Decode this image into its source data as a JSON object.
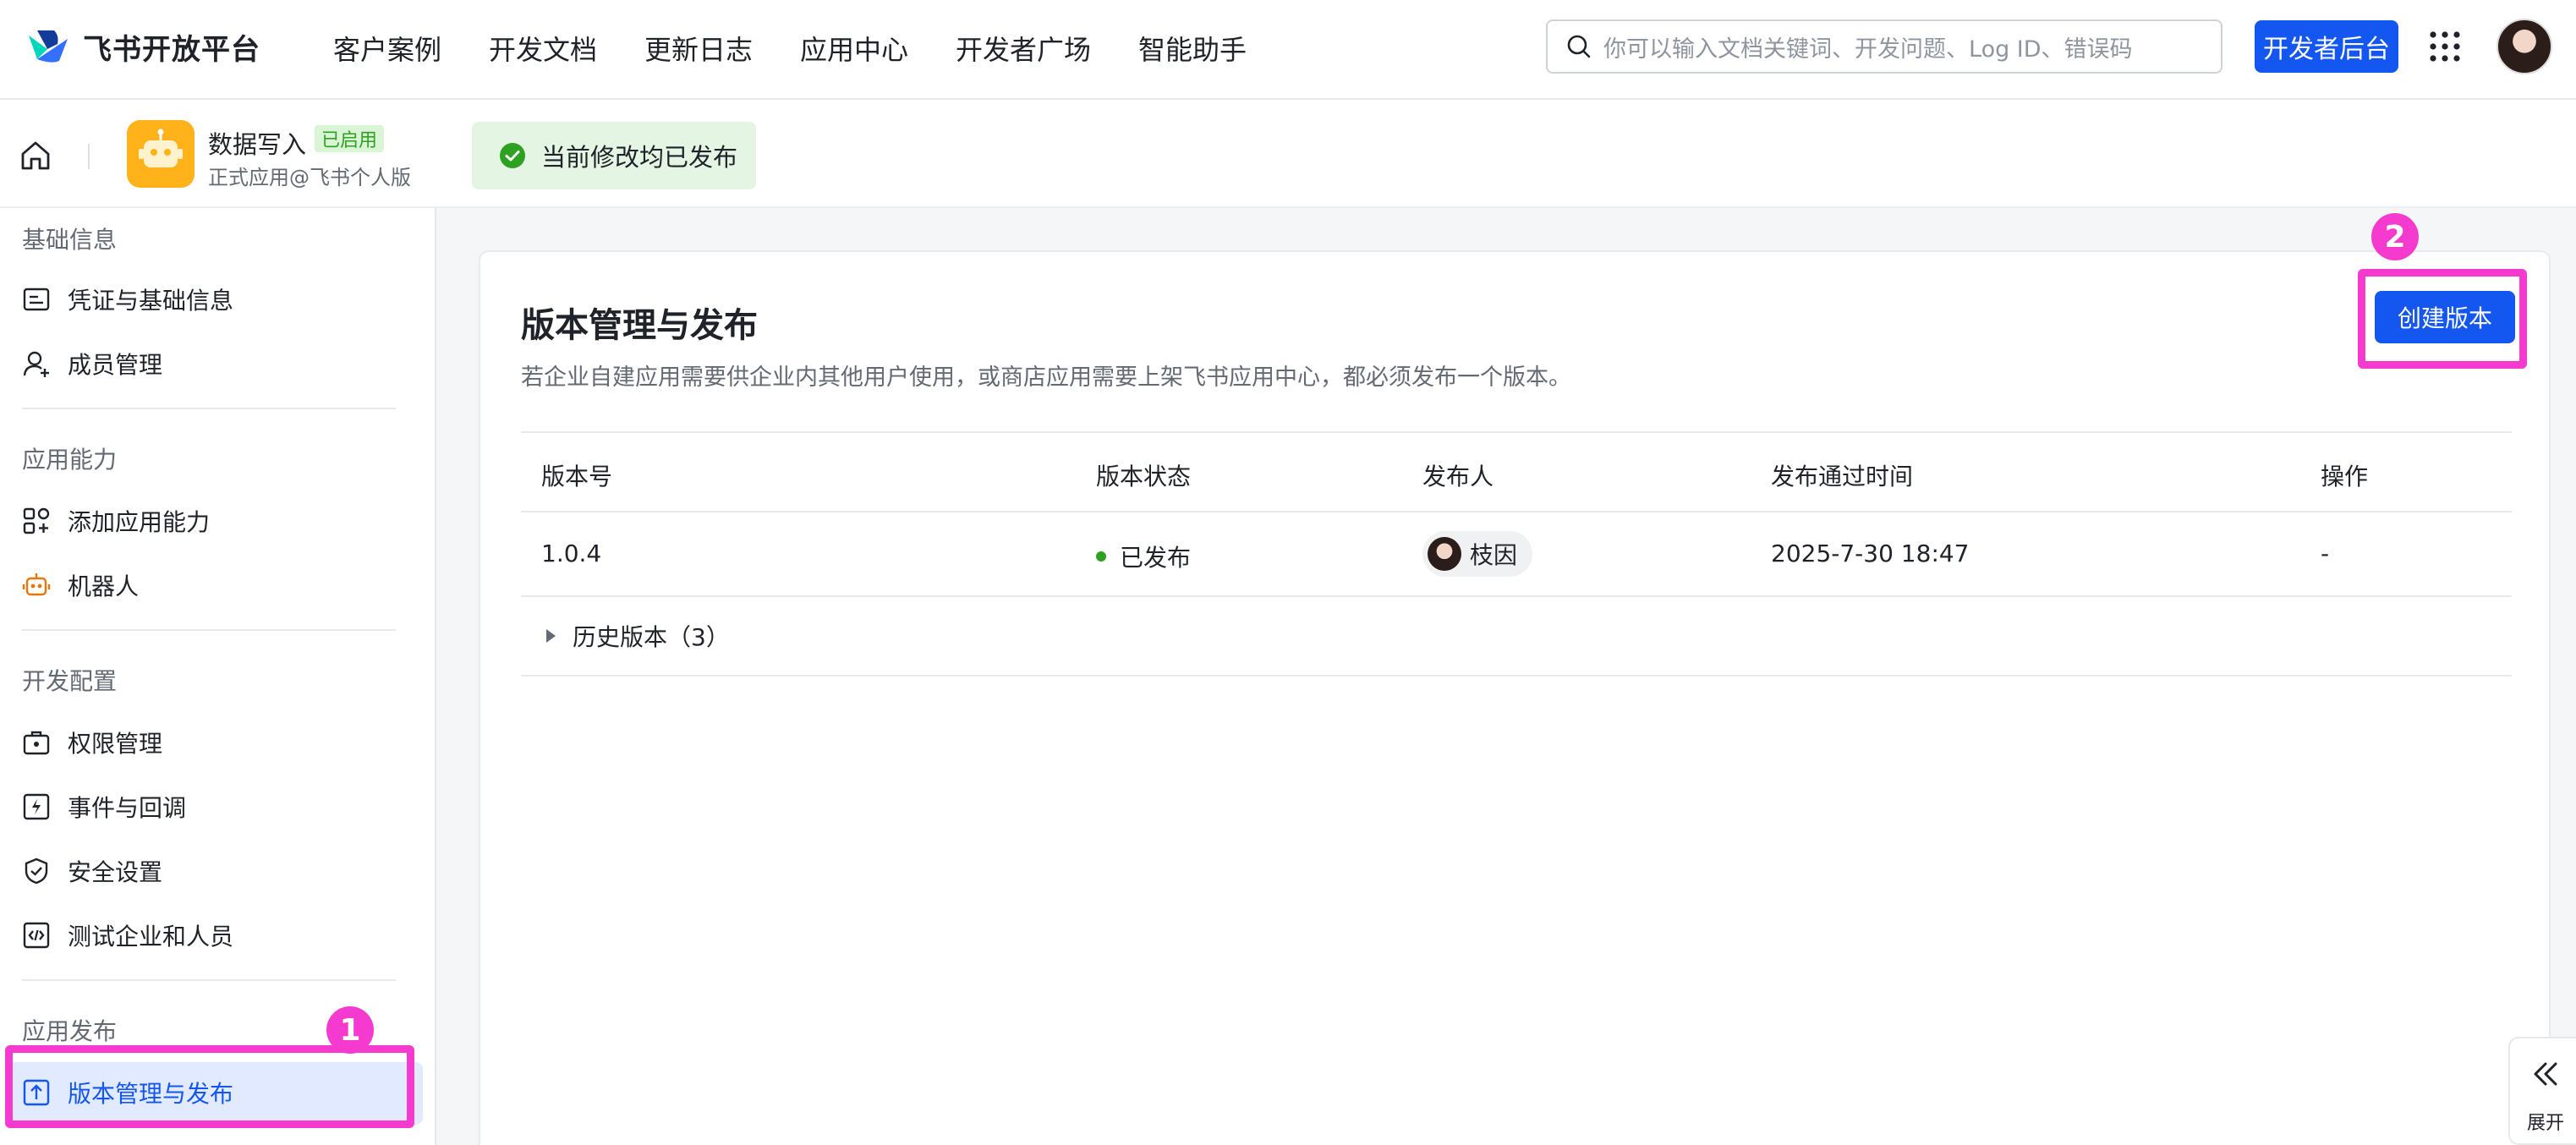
{
  "topnav": {
    "brand": "飞书开放平台",
    "items": [
      "客户案例",
      "开发文档",
      "更新日志",
      "应用中心",
      "开发者广场",
      "智能助手"
    ],
    "search_placeholder": "你可以输入文档关键词、开发问题、Log ID、错误码",
    "dev_console_label": "开发者后台"
  },
  "appbar": {
    "app_name": "数据写入",
    "app_status": "已启用",
    "app_subtitle": "正式应用@飞书个人版",
    "notice": "当前修改均已发布"
  },
  "sidebar": {
    "groups": [
      {
        "title": "基础信息",
        "items": [
          "凭证与基础信息",
          "成员管理"
        ]
      },
      {
        "title": "应用能力",
        "items": [
          "添加应用能力",
          "机器人"
        ]
      },
      {
        "title": "开发配置",
        "items": [
          "权限管理",
          "事件与回调",
          "安全设置",
          "测试企业和人员"
        ]
      },
      {
        "title": "应用发布",
        "items": [
          "版本管理与发布"
        ]
      }
    ]
  },
  "main": {
    "title": "版本管理与发布",
    "description": "若企业自建应用需要供企业内其他用户使用，或商店应用需要上架飞书应用中心，都必须发布一个版本。",
    "create_button": "创建版本",
    "columns": [
      "版本号",
      "版本状态",
      "发布人",
      "发布通过时间",
      "操作"
    ],
    "rows": [
      {
        "version": "1.0.4",
        "status": "已发布",
        "publisher": "枝因",
        "time": "2025-7-30 18:47",
        "action": "-"
      }
    ],
    "history_label": "历史版本（3）"
  },
  "annotations": {
    "badge_1": "1",
    "badge_2": "2"
  },
  "expand_label": "展开",
  "colors": {
    "accent": "#1456f0",
    "highlight": "#f53ad0",
    "success": "#2ea121"
  }
}
